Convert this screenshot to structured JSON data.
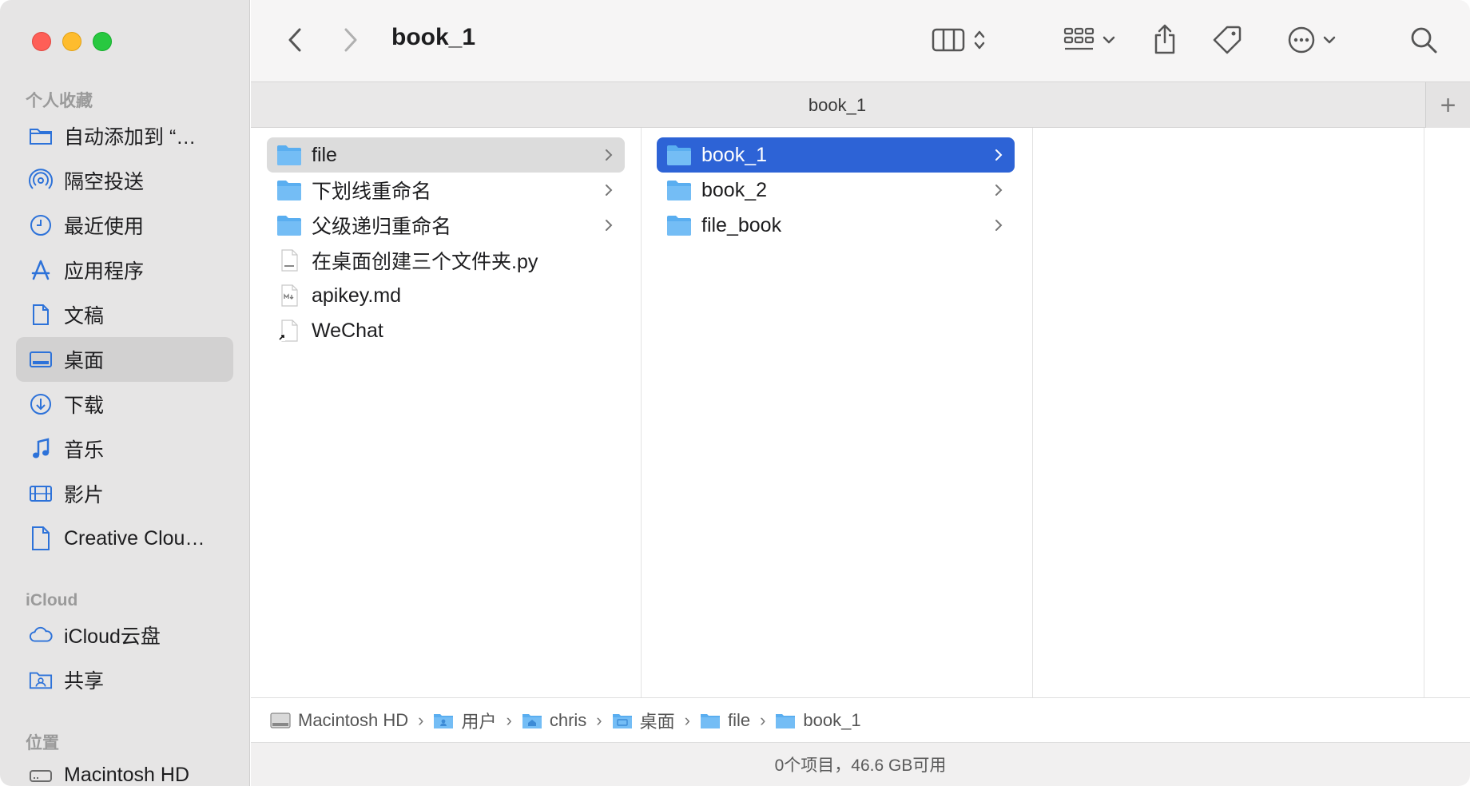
{
  "window": {
    "title": "book_1"
  },
  "sidebar": {
    "favorites_header": "个人收藏",
    "favorites": [
      {
        "label": "自动添加到 “…",
        "icon": "folder-icon"
      },
      {
        "label": "隔空投送",
        "icon": "airdrop-icon"
      },
      {
        "label": "最近使用",
        "icon": "clock-icon"
      },
      {
        "label": "应用程序",
        "icon": "applications-icon"
      },
      {
        "label": "文稿",
        "icon": "document-icon"
      },
      {
        "label": "桌面",
        "icon": "desktop-icon"
      },
      {
        "label": "下载",
        "icon": "download-icon"
      },
      {
        "label": "音乐",
        "icon": "music-icon"
      },
      {
        "label": "影片",
        "icon": "film-icon"
      },
      {
        "label": "Creative Clou…",
        "icon": "file-icon"
      }
    ],
    "icloud_header": "iCloud",
    "icloud": [
      {
        "label": "iCloud云盘",
        "icon": "cloud-icon"
      },
      {
        "label": "共享",
        "icon": "shared-folder-icon"
      }
    ],
    "locations_header": "位置",
    "locations": [
      {
        "label": "Macintosh HD",
        "icon": "disk-icon"
      }
    ]
  },
  "toolbar": {
    "title": "book_1"
  },
  "tabbar": {
    "label": "book_1",
    "add": "+"
  },
  "columns": {
    "col1": [
      {
        "name": "file",
        "type": "folder",
        "chevron": true
      },
      {
        "name": "下划线重命名",
        "type": "folder",
        "chevron": true
      },
      {
        "name": "父级递归重命名",
        "type": "folder",
        "chevron": true
      },
      {
        "name": "在桌面创建三个文件夹.py",
        "type": "python"
      },
      {
        "name": "apikey.md",
        "type": "markdown"
      },
      {
        "name": "WeChat",
        "type": "alias"
      }
    ],
    "col2": [
      {
        "name": "book_1",
        "type": "folder",
        "chevron": true
      },
      {
        "name": "book_2",
        "type": "folder",
        "chevron": true
      },
      {
        "name": "file_book",
        "type": "folder",
        "chevron": true
      }
    ]
  },
  "pathbar": [
    "Macintosh HD",
    "用户",
    "chris",
    "桌面",
    "file",
    "book_1"
  ],
  "status": "0个项目，46.6 GB可用",
  "colors": {
    "accent": "#2d63d6",
    "folder": "#5aaef0"
  }
}
